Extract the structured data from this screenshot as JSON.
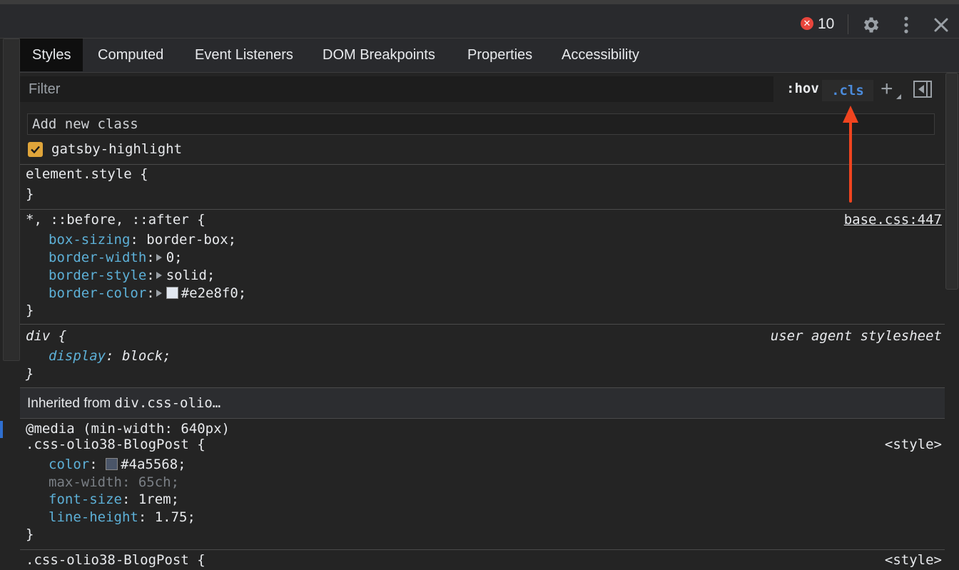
{
  "toolbar": {
    "error_count": "10",
    "icons": [
      "error-icon",
      "gear-icon",
      "kebab-menu-icon",
      "close-icon"
    ]
  },
  "tabs": [
    {
      "label": "Styles",
      "active": true
    },
    {
      "label": "Computed"
    },
    {
      "label": "Event Listeners"
    },
    {
      "label": "DOM Breakpoints"
    },
    {
      "label": "Properties"
    },
    {
      "label": "Accessibility"
    }
  ],
  "filter": {
    "placeholder": "Filter",
    "hov_label": ":hov",
    "cls_label": ".cls"
  },
  "class_panel": {
    "input_placeholder": "Add new class",
    "classes": [
      {
        "name": "gatsby-highlight",
        "checked": true
      }
    ]
  },
  "rules": {
    "element_style": {
      "selector": "element.style {",
      "close": "}"
    },
    "universal": {
      "selector": "*, ::before, ::after {",
      "source": "base.css:447",
      "decls": [
        {
          "prop": "box-sizing",
          "value": "border-box;"
        },
        {
          "prop": "border-width",
          "value": "0;"
        },
        {
          "prop": "border-style",
          "value": "solid;"
        },
        {
          "prop": "border-color",
          "value": "#e2e8f0;",
          "swatch": "#e2e8f0"
        }
      ],
      "close": "}"
    },
    "div": {
      "selector": "div {",
      "source": "user agent stylesheet",
      "decls": [
        {
          "prop": "display",
          "value": "block;"
        }
      ],
      "close": "}"
    },
    "inherited_from": {
      "label": "Inherited from ",
      "selector": "div.css-olio…"
    },
    "blogpost_media": {
      "media": "@media (min-width: 640px)",
      "selector": ".css-olio38-BlogPost {",
      "source": "<style>",
      "decls": [
        {
          "prop": "color",
          "value": "#4a5568;",
          "swatch": "#4a5568"
        },
        {
          "prop": "max-width",
          "value": "65ch;",
          "overridden": true
        },
        {
          "prop": "font-size",
          "value": "1rem;"
        },
        {
          "prop": "line-height",
          "value": "1.75;"
        }
      ],
      "close": "}"
    },
    "blogpost": {
      "selector": ".css-olio38-BlogPost {",
      "source": "<style>"
    }
  },
  "colors": {
    "accent": "#4b8bdb",
    "arrow": "#f0441f",
    "checkbox": "#e0a53a",
    "property": "#5db0d7"
  }
}
